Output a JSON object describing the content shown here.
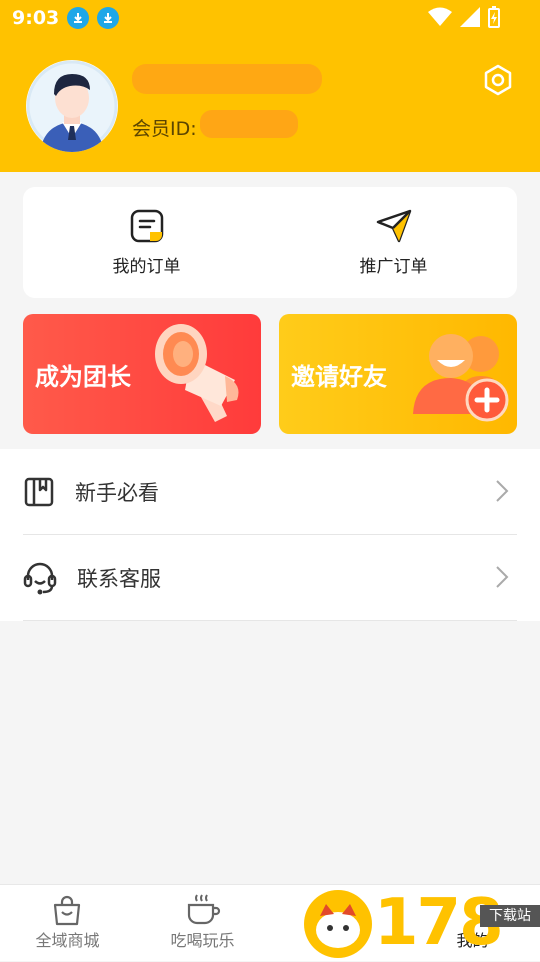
{
  "status": {
    "time": "9:03"
  },
  "profile": {
    "member_label": "会员ID:"
  },
  "orders": [
    {
      "label": "我的订单",
      "icon": "order-list-icon"
    },
    {
      "label": "推广订单",
      "icon": "paper-plane-icon"
    }
  ],
  "banners": [
    {
      "label": "成为团长",
      "color": "#ff4a42",
      "icon": "megaphone-icon"
    },
    {
      "label": "邀请好友",
      "color": "#ffc200",
      "icon": "add-friends-icon"
    }
  ],
  "menu": [
    {
      "label": "新手必看",
      "icon": "book-icon"
    },
    {
      "label": "联系客服",
      "icon": "headset-icon"
    }
  ],
  "tabs": [
    {
      "label": "全域商城",
      "icon": "shopping-bag-icon"
    },
    {
      "label": "吃喝玩乐",
      "icon": "coffee-cup-icon"
    },
    {
      "label": "",
      "icon": ""
    },
    {
      "label": "我的",
      "icon": "profile-icon"
    }
  ],
  "watermark": {
    "text": "178",
    "badge": "下载站"
  },
  "colors": {
    "brand_yellow": "#ffc200",
    "red": "#ff4a42"
  }
}
